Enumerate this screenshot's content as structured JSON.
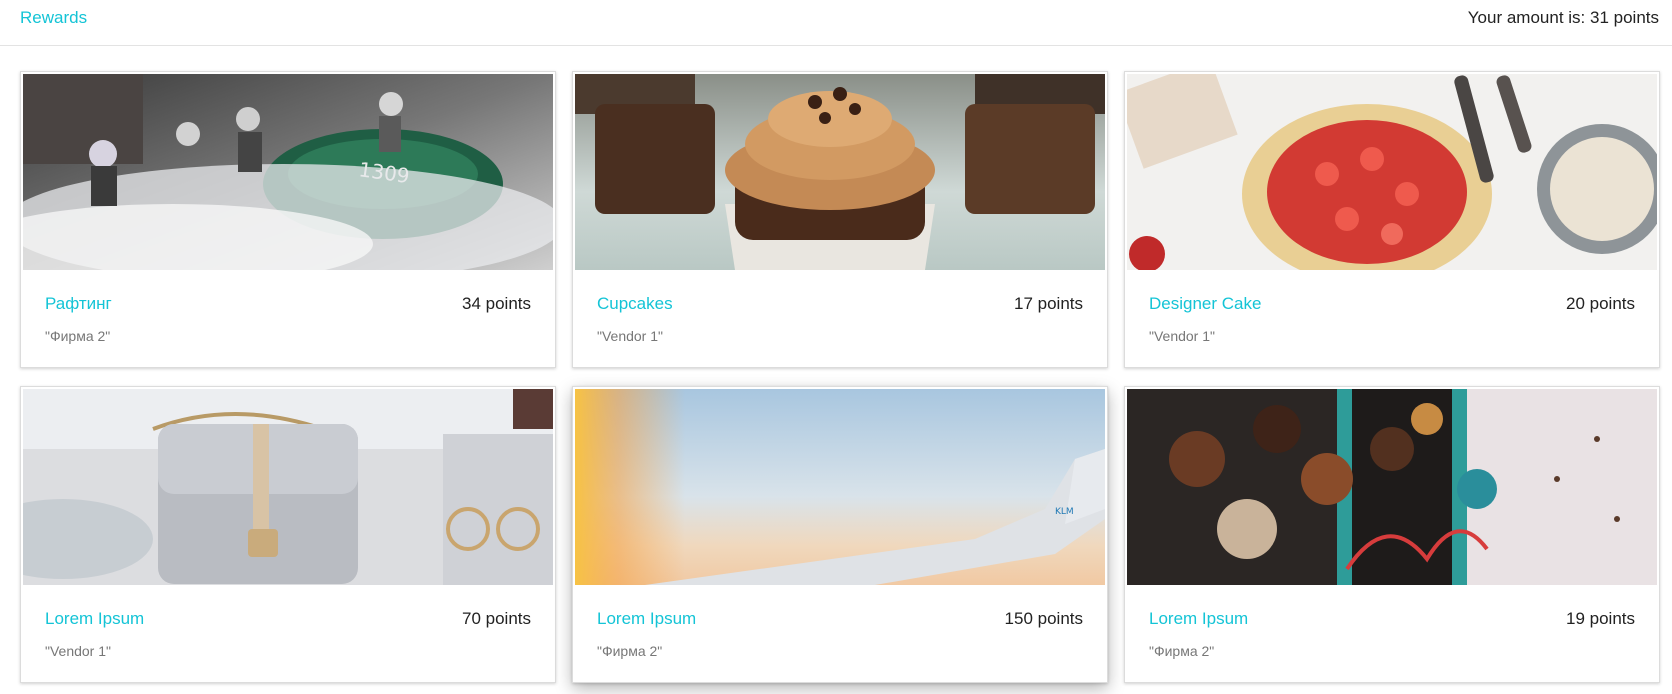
{
  "header": {
    "brand": "Rewards",
    "amount_text": "Your amount is: 31 points"
  },
  "rewards": [
    {
      "title": "Рафтинг",
      "points": "34 points",
      "vendor": "\"Фирма 2\"",
      "image": "rafting-photo"
    },
    {
      "title": "Cupcakes",
      "points": "17 points",
      "vendor": "\"Vendor 1\"",
      "image": "cupcakes-photo"
    },
    {
      "title": "Designer Cake",
      "points": "20 points",
      "vendor": "\"Vendor 1\"",
      "image": "strawberry-galette-photo"
    },
    {
      "title": "Lorem Ipsum",
      "points": "70 points",
      "vendor": "\"Vendor 1\"",
      "image": "handbag-photo"
    },
    {
      "title": "Lorem Ipsum",
      "points": "150 points",
      "vendor": "\"Фирма 2\"",
      "image": "airplane-wing-photo"
    },
    {
      "title": "Lorem Ipsum",
      "points": "19 points",
      "vendor": "\"Фирма 2\"",
      "image": "chocolates-photo"
    }
  ],
  "colors": {
    "accent": "#14c4d6",
    "text": "#222222",
    "muted": "#777777"
  }
}
